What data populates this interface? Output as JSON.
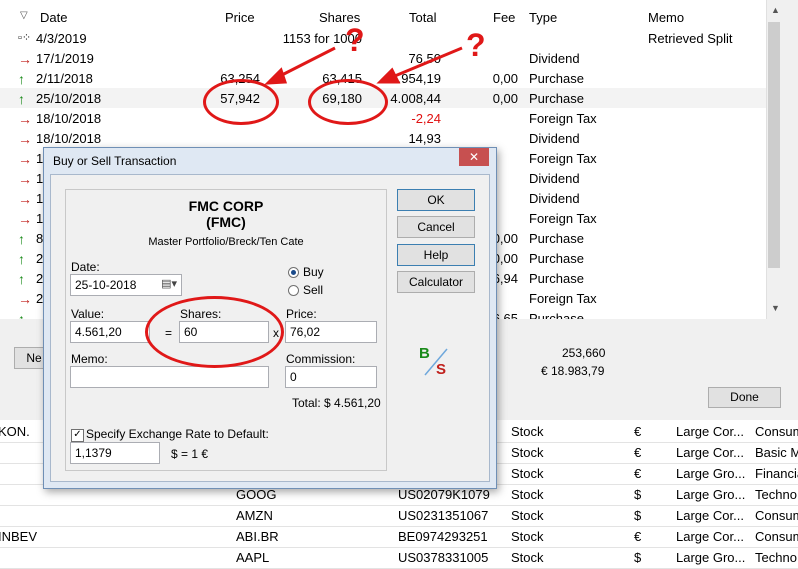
{
  "columns": {
    "date": "Date",
    "price": "Price",
    "shares": "Shares",
    "total": "Total",
    "fee": "Fee",
    "type": "Type",
    "memo": "Memo"
  },
  "rows": [
    {
      "icon": "split",
      "date": "4/3/2019",
      "price": "",
      "shares": "1153 for 1000",
      "total": "",
      "fee": "",
      "type": "",
      "memo": "Retrieved Split"
    },
    {
      "icon": "right",
      "date": "17/1/2019",
      "price": "",
      "shares": "",
      "total": "76,50",
      "fee": "",
      "type": "Dividend",
      "memo": ""
    },
    {
      "icon": "up",
      "date": "2/11/2018",
      "price": "63,254",
      "shares": "63,415",
      "total": "3.954,19",
      "fee": "0,00",
      "type": "Purchase",
      "memo": ""
    },
    {
      "icon": "up",
      "date": "25/10/2018",
      "price": "57,942",
      "shares": "69,180",
      "total": "4.008,44",
      "fee": "0,00",
      "type": "Purchase",
      "memo": ""
    },
    {
      "icon": "right",
      "date": "18/10/2018",
      "price": "",
      "shares": "",
      "total": "-2,24",
      "fee": "",
      "type": "Foreign Tax",
      "memo": ""
    },
    {
      "icon": "right",
      "date": "18/10/2018",
      "price": "",
      "shares": "",
      "total": "14,93",
      "fee": "",
      "type": "Dividend",
      "memo": ""
    },
    {
      "icon": "right",
      "date": "1",
      "price": "",
      "shares": "",
      "total": "",
      "fee": "",
      "type": "Foreign Tax",
      "memo": ""
    },
    {
      "icon": "right",
      "date": "1",
      "price": "",
      "shares": "",
      "total": "",
      "fee": "",
      "type": "Dividend",
      "memo": ""
    },
    {
      "icon": "right",
      "date": "1",
      "price": "",
      "shares": "",
      "total": "",
      "fee": "",
      "type": "Dividend",
      "memo": ""
    },
    {
      "icon": "right",
      "date": "1",
      "price": "",
      "shares": "",
      "total": "",
      "fee": "",
      "type": "Foreign Tax",
      "memo": ""
    },
    {
      "icon": "up",
      "date": "8",
      "price": "",
      "shares": "",
      "total": "",
      "fee": "0,00",
      "type": "Purchase",
      "memo": ""
    },
    {
      "icon": "up",
      "date": "2",
      "price": "",
      "shares": "",
      "total": "",
      "fee": "0,00",
      "type": "Purchase",
      "memo": ""
    },
    {
      "icon": "up",
      "date": "2",
      "price": "",
      "shares": "",
      "total": "",
      "fee": "6,94",
      "type": "Purchase",
      "memo": ""
    },
    {
      "icon": "right",
      "date": "2",
      "price": "",
      "shares": "",
      "total": "",
      "fee": "",
      "type": "Foreign Tax",
      "memo": ""
    },
    {
      "icon": "up",
      "date": "",
      "price": "",
      "shares": "",
      "total": "",
      "fee": "6,65",
      "type": "Purchase",
      "memo": ""
    }
  ],
  "footer": {
    "new_label": "Ne",
    "shares_total": "253,660",
    "value_total": "€ 18.983,79",
    "done_label": "Done"
  },
  "bottom_list": [
    {
      "name": "KON.",
      "ticker": "",
      "isin": "",
      "kind": "Stock",
      "cur": "€",
      "cap": "Large Cor...",
      "sector": "Consum"
    },
    {
      "name": "",
      "ticker": "",
      "isin": "",
      "kind": "Stock",
      "cur": "€",
      "cap": "Large Cor...",
      "sector": "Basic M"
    },
    {
      "name": "",
      "ticker": "",
      "isin": "",
      "kind": "Stock",
      "cur": "€",
      "cap": "Large Gro...",
      "sector": "Financia"
    },
    {
      "name": "",
      "ticker": "GOOG",
      "isin": "US02079K1079",
      "kind": "Stock",
      "cur": "$",
      "cap": "Large Gro...",
      "sector": "Techno"
    },
    {
      "name": "",
      "ticker": "AMZN",
      "isin": "US0231351067",
      "kind": "Stock",
      "cur": "$",
      "cap": "Large Cor...",
      "sector": "Consum"
    },
    {
      "name": "INBEV",
      "ticker": "ABI.BR",
      "isin": "BE0974293251",
      "kind": "Stock",
      "cur": "€",
      "cap": "Large Cor...",
      "sector": "Consum"
    },
    {
      "name": "",
      "ticker": "AAPL",
      "isin": "US0378331005",
      "kind": "Stock",
      "cur": "$",
      "cap": "Large Gro...",
      "sector": "Techno"
    }
  ],
  "dialog": {
    "title": "Buy or Sell Transaction",
    "company": "FMC CORP",
    "ticker": "(FMC)",
    "portfolio": "Master Portfolio/Breck/Ten Cate",
    "date_label": "Date:",
    "date_value": "25-10-2018",
    "buy_label": "Buy",
    "sell_label": "Sell",
    "value_label": "Value:",
    "value_value": "4.561,20",
    "eq": "=",
    "shares_label": "Shares:",
    "shares_value": "60",
    "x": "x",
    "price_label": "Price:",
    "price_value": "76,02",
    "memo_label": "Memo:",
    "commission_label": "Commission:",
    "commission_value": "0",
    "total_text": "Total: $ 4.561,20",
    "exch_label": "Specify Exchange Rate to Default:",
    "exch_value": "1,1379",
    "exch_unit": "$ = 1 €",
    "ok": "OK",
    "cancel": "Cancel",
    "help": "Help",
    "calculator": "Calculator",
    "bs_b": "B",
    "bs_s": "S"
  },
  "annotations": {
    "q1": "?",
    "q2": "?"
  },
  "colors": {
    "annotation": "#e01818",
    "buy_green": "#1a8a1a",
    "sell_red": "#c0201c",
    "negative": "#e01010"
  }
}
